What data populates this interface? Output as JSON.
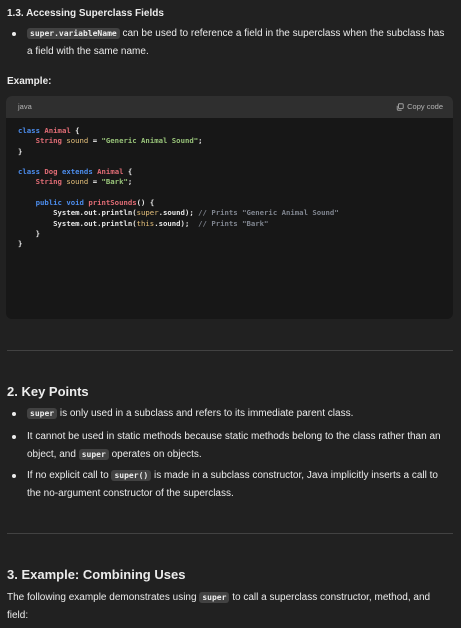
{
  "section13": {
    "title": "1.3. Accessing Superclass Fields",
    "bullet_code": "super.variableName",
    "bullet_text": " can be used to reference a field in the superclass when the subclass has a field with the same name.",
    "example_label": "Example:"
  },
  "code_block": {
    "language": "java",
    "copy_label": "Copy code"
  },
  "section2": {
    "title": "2. Key Points",
    "bullets": [
      {
        "code": "super",
        "text": " is only used in a subclass and refers to its immediate parent class."
      },
      {
        "pre": "It cannot be used in static methods because static methods belong to the class rather than an object, and ",
        "code": "super",
        "post": " operates on objects."
      },
      {
        "pre": "If no explicit call to ",
        "code": "super()",
        "post": " is made in a subclass constructor, Java implicitly inserts a call to the no-argument constructor of the superclass."
      }
    ]
  },
  "section3": {
    "title": "3. Example: Combining Uses",
    "pre": "The following example demonstrates using ",
    "code": "super",
    "post": " to call a superclass constructor, method, and field:"
  },
  "colors": {
    "background": "#212121",
    "code_background": "#171717",
    "code_header": "#2f2f2f",
    "keyword": "#4c8ded",
    "type_name": "#e06c75",
    "field": "#e5c07b",
    "string": "#98c379",
    "comment": "#7f848e"
  },
  "icons": [
    "copy-icon"
  ]
}
